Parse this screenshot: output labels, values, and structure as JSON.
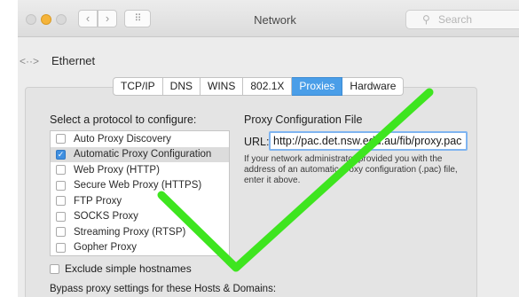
{
  "window": {
    "title": "Network",
    "search_placeholder": "Search",
    "nav_back": "‹",
    "nav_forward": "›",
    "grid_icon": "⠿"
  },
  "pane": {
    "title": "Ethernet",
    "back_glyph": "<··>"
  },
  "tabs": [
    {
      "label": "TCP/IP",
      "active": false
    },
    {
      "label": "DNS",
      "active": false
    },
    {
      "label": "WINS",
      "active": false
    },
    {
      "label": "802.1X",
      "active": false
    },
    {
      "label": "Proxies",
      "active": true
    },
    {
      "label": "Hardware",
      "active": false
    }
  ],
  "protocols": {
    "heading": "Select a protocol to configure:",
    "items": [
      {
        "label": "Auto Proxy Discovery",
        "checked": false,
        "selected": false
      },
      {
        "label": "Automatic Proxy Configuration",
        "checked": true,
        "selected": true
      },
      {
        "label": "Web Proxy (HTTP)",
        "checked": false,
        "selected": false
      },
      {
        "label": "Secure Web Proxy (HTTPS)",
        "checked": false,
        "selected": false
      },
      {
        "label": "FTP Proxy",
        "checked": false,
        "selected": false
      },
      {
        "label": "SOCKS Proxy",
        "checked": false,
        "selected": false
      },
      {
        "label": "Streaming Proxy (RTSP)",
        "checked": false,
        "selected": false
      },
      {
        "label": "Gopher Proxy",
        "checked": false,
        "selected": false
      }
    ]
  },
  "exclude": {
    "label": "Exclude simple hostnames",
    "checked": false
  },
  "bypass": {
    "label": "Bypass proxy settings for these Hosts & Domains:"
  },
  "pac": {
    "title": "Proxy Configuration File",
    "url_label": "URL:",
    "url_value": "http://pac.det.nsw.edu.au/fib/proxy.pac",
    "help": "If your network administrator provided you with the address of an automatic proxy configuration (.pac) file, enter it above."
  },
  "overlay": {
    "icon": "checkmark-icon",
    "color": "#3ee51f"
  },
  "colors": {
    "accent": "#4a9ee8",
    "checkbox": "#3f8fe0",
    "focus_ring": "#7fb4f0"
  }
}
